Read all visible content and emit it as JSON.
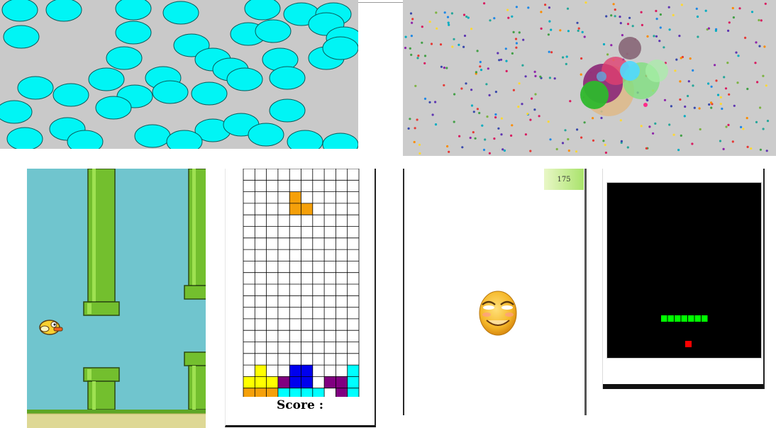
{
  "panels": {
    "bubbles": {
      "bubble_color": "#00f5f5",
      "background": "#c9c9c9"
    },
    "agar": {
      "background": "#cccccc"
    },
    "flappy": {
      "sky": "#70c5ce",
      "pipe_color": "#73bf2e",
      "ground": "#ded895"
    },
    "tetris": {
      "score_label": "Score :",
      "colors": {
        "orange": "#f5a00a",
        "yellow": "#ffff00",
        "blue": "#0000ee",
        "purple": "#800080",
        "cyan": "#00ffff"
      }
    },
    "dodge": {
      "score": "175"
    },
    "snake": {
      "snake_color": "#00ff00",
      "food_color": "#ff0000",
      "snake_length": 7
    }
  }
}
